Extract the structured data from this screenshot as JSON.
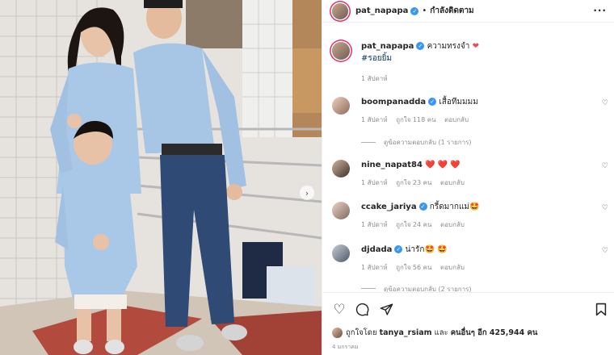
{
  "post": {
    "username": "pat_napapa",
    "following_label": "กำลังติดตาม",
    "caption_text": "ความทรงจำ",
    "caption_emoji": "❤️",
    "hashtag": "#รอยยิ้ม",
    "caption_time": "1 สัปดาห์",
    "more_icon": "more-options-icon"
  },
  "comments": [
    {
      "username": "boompanadda",
      "verified": true,
      "text": "เสื้อทีมมมม",
      "time": "1 สัปดาห์",
      "likes": "ถูกใจ 118 คน",
      "reply": "ตอบกลับ",
      "view_replies": "ดูข้อความตอบกลับ (1 รายการ)"
    },
    {
      "username": "nine_napat84",
      "verified": false,
      "text": "❤️ ❤️ ❤️",
      "time": "1 สัปดาห์",
      "likes": "ถูกใจ 23 คน",
      "reply": "ตอบกลับ"
    },
    {
      "username": "ccake_jariya",
      "verified": true,
      "text": "กรี้ดมากแม่🤩",
      "time": "1 สัปดาห์",
      "likes": "ถูกใจ 24 คน",
      "reply": "ตอบกลับ"
    },
    {
      "username": "djdada",
      "verified": true,
      "text": "น่ารัก🤩 🤩",
      "time": "1 สัปดาห์",
      "likes": "ถูกใจ 56 คน",
      "reply": "ตอบกลับ",
      "view_replies": "ดูข้อความตอบกลับ (2 รายการ)"
    }
  ],
  "footer": {
    "liked_by_prefix": "ถูกใจโดย",
    "liked_by_user": "tanya_rsiam",
    "liked_by_and": "และ",
    "liked_by_others": "คนอื่นๆ อีก 425,944 คน",
    "date": "4 มกราคม"
  },
  "colors": {
    "accent_blue": "#3897f0",
    "heart_red": "#ed4956",
    "muted": "#8e8e8e",
    "shirt_blue": "#a9c8e8"
  }
}
